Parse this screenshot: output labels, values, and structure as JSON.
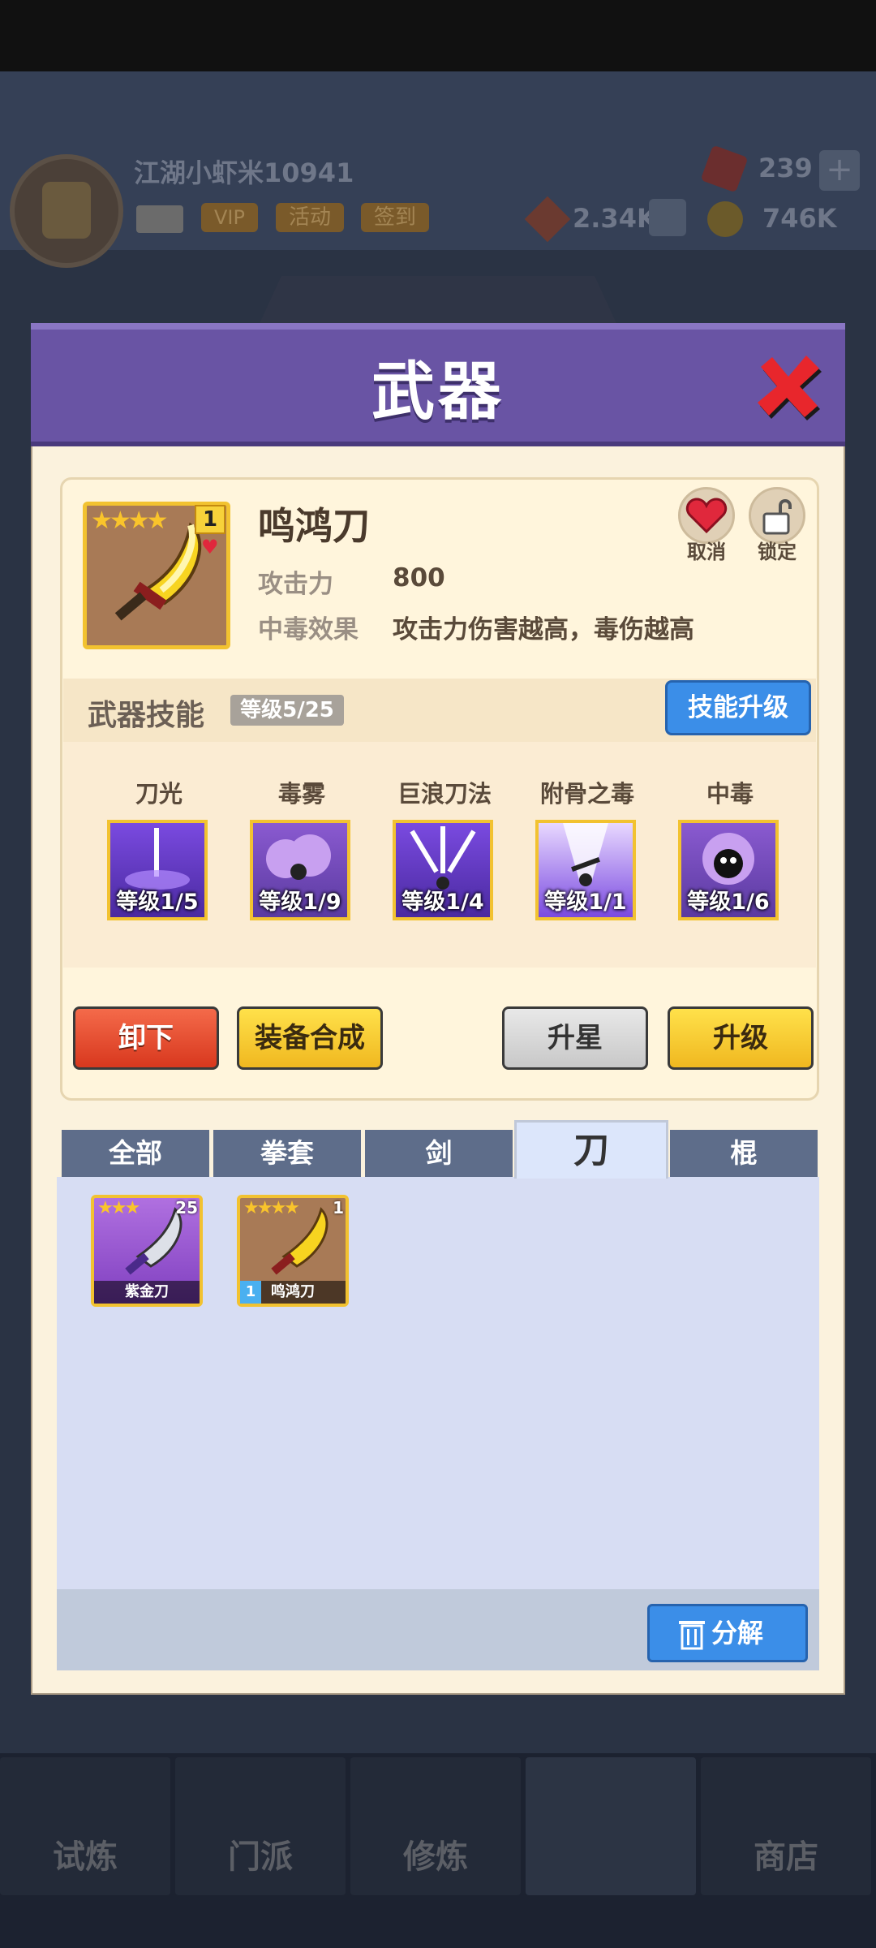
{
  "background": {
    "username": "江湖小虾米10941",
    "vip_label": "VIP",
    "activity_label": "活动",
    "signin_label": "签到",
    "gems": "239",
    "power": "2.34K",
    "coins": "746K",
    "bottom_nav": [
      {
        "label": "试炼"
      },
      {
        "label": "门派"
      },
      {
        "label": "修炼"
      },
      {
        "label": ""
      },
      {
        "label": "商店"
      }
    ]
  },
  "dialog": {
    "title": "武器",
    "weapon": {
      "name": "鸣鸿刀",
      "stars": "★★★★",
      "level": "1",
      "attack_label": "攻击力",
      "attack_value": "800",
      "effect_label": "中毒效果",
      "effect_value": "攻击力伤害越高，毒伤越高",
      "cancel_label": "取消",
      "lock_label": "锁定"
    },
    "skills": {
      "title": "武器技能",
      "grade": "等级5/25",
      "upgrade_label": "技能升级",
      "items": [
        {
          "name": "刀光",
          "level": "等级1/5"
        },
        {
          "name": "毒雾",
          "level": "等级1/9"
        },
        {
          "name": "巨浪刀法",
          "level": "等级1/4"
        },
        {
          "name": "附骨之毒",
          "level": "等级1/1"
        },
        {
          "name": "中毒",
          "level": "等级1/6"
        }
      ]
    },
    "actions": {
      "unequip": "卸下",
      "forge": "装备合成",
      "star_up": "升星",
      "upgrade": "升级"
    },
    "inventory": {
      "tabs": [
        "全部",
        "拳套",
        "剑",
        "刀",
        "棍"
      ],
      "active_tab": "刀",
      "items": [
        {
          "name": "紫金刀",
          "stars": "★★★",
          "count": "25"
        },
        {
          "name": "鸣鸿刀",
          "stars": "★★★★",
          "count": "1",
          "equipped_badge": "1"
        }
      ],
      "decompose_label": "分解"
    }
  },
  "colors": {
    "header_purple": "#6954a4",
    "gold_border": "#f2c230",
    "blue_button": "#3b8ee8",
    "red_button": "#d8381e"
  }
}
